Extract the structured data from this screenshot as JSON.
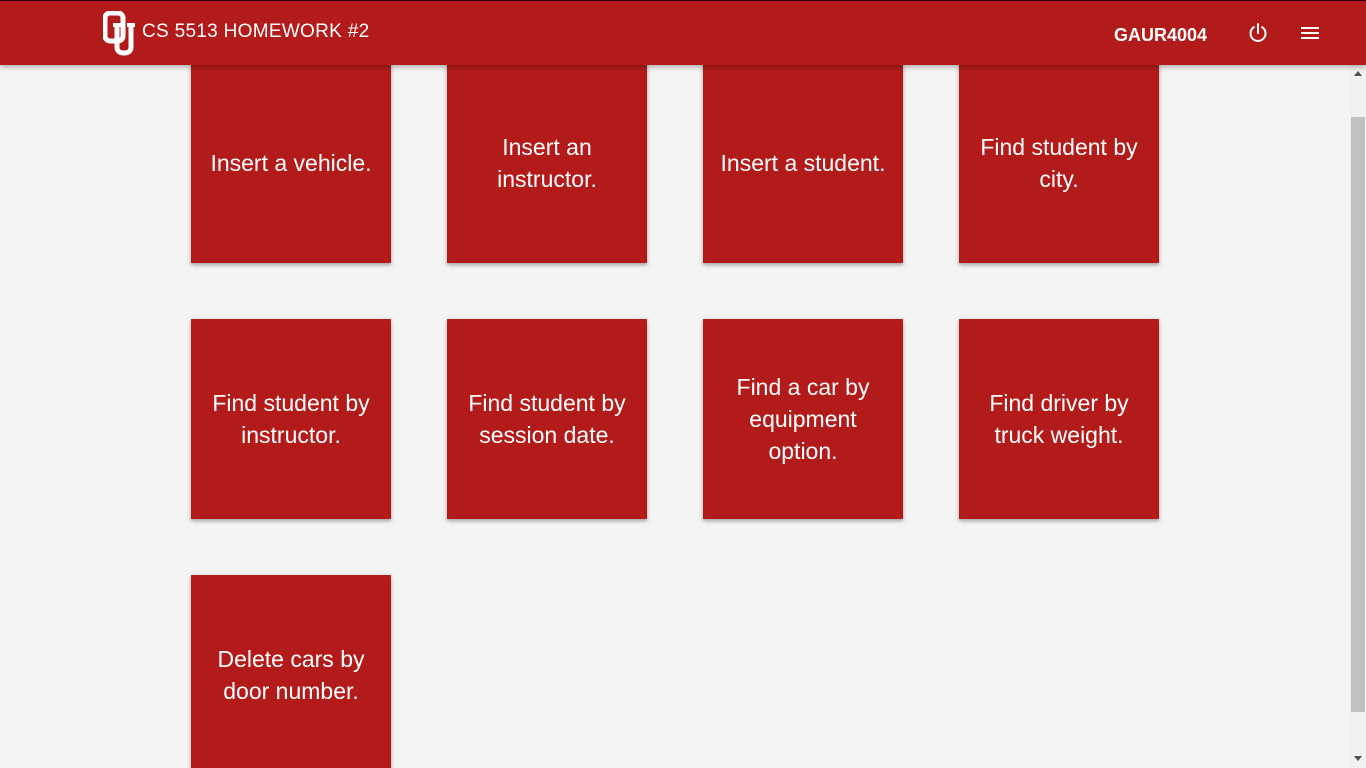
{
  "header": {
    "title": "CS 5513 HOMEWORK #2",
    "username": "GAUR4004",
    "brand_color": "#b31b1b",
    "icons": [
      "ou-logo-icon",
      "power-icon",
      "menu-icon"
    ]
  },
  "cards": [
    {
      "label": "Insert a vehicle."
    },
    {
      "label": "Insert an instructor."
    },
    {
      "label": "Insert a student."
    },
    {
      "label": "Find student by city."
    },
    {
      "label": "Find student by instructor."
    },
    {
      "label": "Find student by session date."
    },
    {
      "label": "Find a car by equipment option."
    },
    {
      "label": "Find driver by truck weight."
    },
    {
      "label": "Delete cars by door number."
    }
  ]
}
